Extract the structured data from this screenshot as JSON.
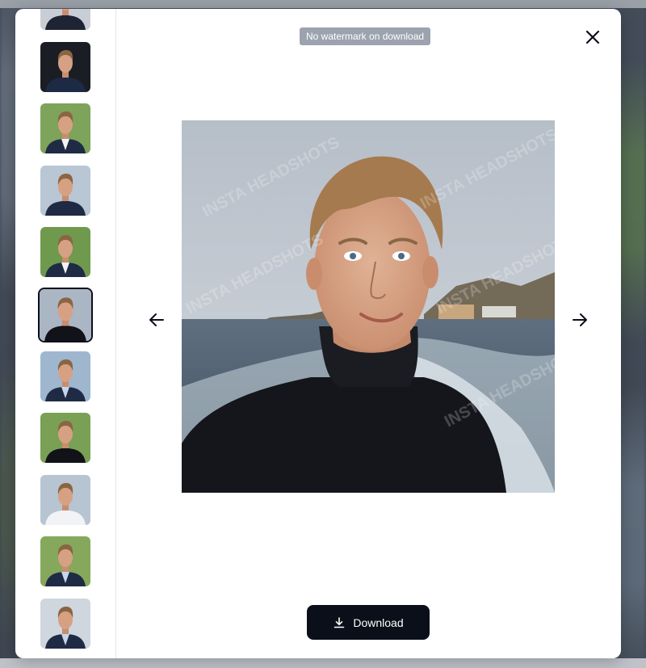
{
  "modal": {
    "badge_text": "No watermark on download",
    "download_label": "Download",
    "watermark_text": "INSTA HEADSHOTS"
  },
  "icons": {
    "close": "close-icon",
    "prev": "arrow-left-icon",
    "next": "arrow-right-icon",
    "download": "download-icon"
  },
  "colors": {
    "primary": "#0b0f1a",
    "badge_bg": "#9ca3af",
    "modal_bg": "#ffffff",
    "divider": "#e4e6ea"
  },
  "thumbnails": [
    {
      "bg": "#c9ced6",
      "jacket": "#1e2433",
      "shirt": "#1e2433"
    },
    {
      "bg": "#1a1d24",
      "jacket": "#1d2a44",
      "shirt": "#1d2a44"
    },
    {
      "bg": "#7ea35a",
      "jacket": "#1f2b45",
      "shirt": "#f1f3f6"
    },
    {
      "bg": "#b9c6d3",
      "jacket": "#1f2b45",
      "shirt": "#1f2b45"
    },
    {
      "bg": "#6f9a4e",
      "jacket": "#1f2b45",
      "shirt": "#f1f3f6"
    },
    {
      "bg": "#aab6c4",
      "jacket": "#111318",
      "shirt": "#111318",
      "selected": true
    },
    {
      "bg": "#9fb6cf",
      "jacket": "#1f2b45",
      "shirt": "#c7d5ea"
    },
    {
      "bg": "#7aa055",
      "jacket": "#111318",
      "shirt": "#111318"
    },
    {
      "bg": "#b7c4d1",
      "jacket": "#f1f3f6",
      "shirt": "#f1f3f6"
    },
    {
      "bg": "#86a85c",
      "jacket": "#1f2b45",
      "shirt": "#c7d5ea"
    },
    {
      "bg": "#cfd6de",
      "jacket": "#1f2b45",
      "shirt": "#c7d5ea"
    }
  ]
}
